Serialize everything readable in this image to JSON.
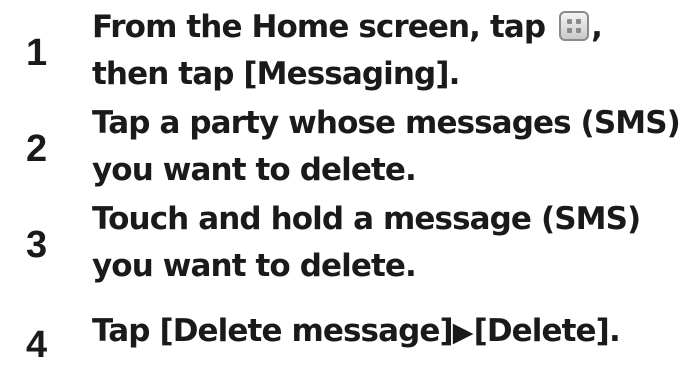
{
  "steps": [
    {
      "number": "1",
      "line1_before_icon": "From the Home screen, tap ",
      "line1_after_icon": ",",
      "line2": "then tap [Messaging].",
      "icon": "apps-grid-icon"
    },
    {
      "number": "2",
      "line1": "Tap a party whose messages (SMS)",
      "line2": "you want to delete."
    },
    {
      "number": "3",
      "line1": "Touch and hold a message (SMS)",
      "line2": "you want to delete."
    },
    {
      "number": "4",
      "part1": "Tap [Delete message]",
      "arrow": "▶",
      "part2": "[Delete]."
    }
  ],
  "colors": {
    "text": "#1a1a1a",
    "background": "#ffffff",
    "icon_border": "#8a8a8a"
  }
}
